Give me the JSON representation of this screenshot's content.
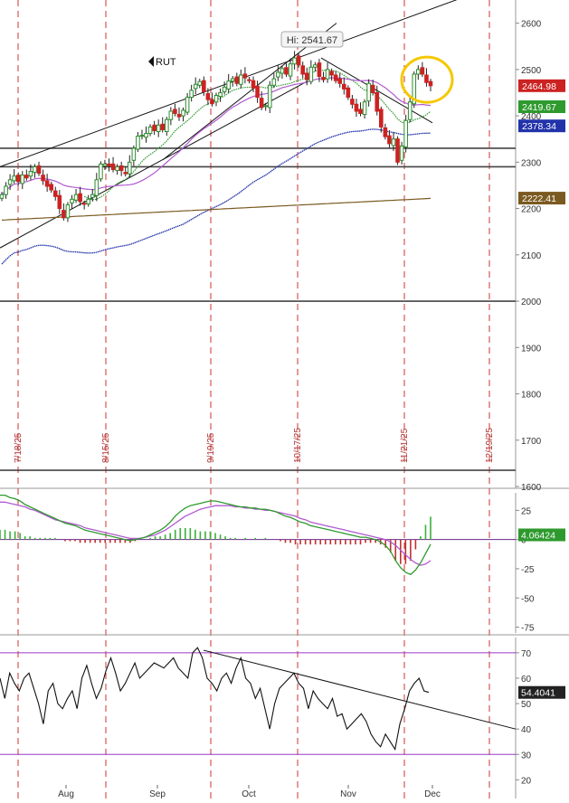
{
  "symbol": "RUT",
  "high_label": "Hi: 2541.67",
  "colors": {
    "up": "#2e8b2e",
    "down": "#cc2222",
    "ma_short": "#2e9a2e",
    "ma_mid": "#b05ad0",
    "ma_long": "#2233aa",
    "ma_200": "#7a5a20",
    "event_line": "#cc3333",
    "trend_line": "#111111",
    "highlight": "#f5c800",
    "macd_line": "#2e9a2e",
    "signal_line": "#b05ad0",
    "rsi_line": "#111111",
    "rsi_band": "#9a38c8"
  },
  "x_axis": {
    "labels": [
      "Aug",
      "Sep",
      "Oct",
      "Nov",
      "Dec"
    ]
  },
  "event_dates": [
    "7/18/25",
    "8/15/25",
    "9/19/25",
    "10/17/25",
    "11/21/25",
    "12/19/25"
  ],
  "chart_data": [
    {
      "type": "candlestick",
      "series_name": "RUT",
      "ylim": [
        1600,
        2650
      ],
      "y_ticks": [
        1600,
        1700,
        1800,
        1900,
        2000,
        2100,
        2200,
        2300,
        2400,
        2500,
        2600
      ],
      "horizontal_levels": [
        2330,
        2290,
        2000,
        1635
      ],
      "price_tags": [
        {
          "value": "2464.98",
          "level": 2464.98,
          "kind": "last"
        },
        {
          "value": "2419.67",
          "level": 2419.67,
          "kind": "ma_short"
        },
        {
          "value": "2378.34",
          "level": 2378.34,
          "kind": "ma_long"
        },
        {
          "value": "2222.41",
          "level": 2222.41,
          "kind": "ma_200"
        }
      ],
      "closes": [
        2230,
        2248,
        2262,
        2270,
        2258,
        2272,
        2266,
        2280,
        2290,
        2276,
        2260,
        2248,
        2240,
        2226,
        2200,
        2180,
        2208,
        2220,
        2230,
        2215,
        2210,
        2220,
        2230,
        2262,
        2296,
        2296,
        2292,
        2284,
        2290,
        2282,
        2275,
        2300,
        2330,
        2356,
        2358,
        2362,
        2376,
        2368,
        2380,
        2370,
        2392,
        2410,
        2405,
        2398,
        2412,
        2440,
        2455,
        2468,
        2474,
        2452,
        2435,
        2426,
        2444,
        2450,
        2462,
        2475,
        2480,
        2470,
        2488,
        2482,
        2476,
        2460,
        2440,
        2418,
        2422,
        2466,
        2480,
        2494,
        2502,
        2490,
        2512,
        2525,
        2510,
        2490,
        2478,
        2505,
        2510,
        2485,
        2478,
        2500,
        2488,
        2476,
        2470,
        2458,
        2440,
        2425,
        2410,
        2405,
        2430,
        2470,
        2450,
        2410,
        2376,
        2355,
        2340,
        2350,
        2300,
        2335,
        2390,
        2430,
        2490,
        2500,
        2490,
        2472,
        2465
      ]
    },
    {
      "type": "line",
      "indicator": "MACD",
      "ylim": [
        -80,
        40
      ],
      "y_ticks": [
        -75,
        -50,
        -25,
        0,
        25
      ],
      "last_value": "4.06424",
      "macd": [
        38,
        38,
        36,
        35,
        33,
        30,
        28,
        26,
        24,
        22,
        20,
        18,
        16,
        14,
        13,
        12,
        10,
        8,
        7,
        6,
        5,
        4,
        3,
        2,
        1,
        0,
        -1,
        0,
        1,
        2,
        4,
        6,
        8,
        11,
        15,
        20,
        24,
        27,
        29,
        30,
        31,
        32,
        33,
        33,
        32,
        31,
        30,
        29,
        28,
        28,
        27,
        27,
        26,
        26,
        25,
        24,
        22,
        20,
        19,
        17,
        15,
        14,
        12,
        11,
        10,
        9,
        8,
        7,
        6,
        5,
        4,
        3,
        2,
        2,
        1,
        0,
        -2,
        -5,
        -10,
        -18,
        -24,
        -28,
        -30,
        -26,
        -20,
        -12,
        -4
      ],
      "signal": [
        32,
        32,
        31,
        30,
        29,
        28,
        26,
        25,
        23,
        21,
        19,
        17,
        16,
        15,
        14,
        13,
        12,
        10,
        9,
        8,
        7,
        6,
        5,
        4,
        3,
        2,
        1,
        1,
        1,
        2,
        3,
        4,
        6,
        8,
        11,
        14,
        17,
        20,
        22,
        24,
        26,
        27,
        28,
        29,
        29,
        29,
        29,
        28,
        28,
        27,
        27,
        26,
        26,
        25,
        25,
        24,
        23,
        22,
        21,
        20,
        18,
        17,
        15,
        14,
        13,
        12,
        11,
        10,
        9,
        8,
        7,
        6,
        5,
        4,
        3,
        2,
        1,
        0,
        -2,
        -5,
        -9,
        -13,
        -17,
        -20,
        -22,
        -21,
        -18
      ]
    },
    {
      "type": "line",
      "indicator": "RSI",
      "ylim": [
        18,
        76
      ],
      "y_ticks": [
        20,
        30,
        40,
        50,
        60,
        70
      ],
      "bands": [
        70,
        30
      ],
      "last_value": "54.4041",
      "values": [
        60,
        52,
        62,
        58,
        55,
        60,
        62,
        56,
        50,
        42,
        55,
        58,
        50,
        48,
        52,
        55,
        48,
        60,
        65,
        58,
        52,
        56,
        63,
        68,
        62,
        55,
        58,
        62,
        66,
        60,
        62,
        64,
        66,
        65,
        64,
        66,
        68,
        64,
        62,
        60,
        70,
        72,
        68,
        60,
        58,
        55,
        60,
        62,
        58,
        64,
        68,
        60,
        58,
        52,
        56,
        48,
        40,
        50,
        56,
        58,
        60,
        62,
        58,
        56,
        48,
        55,
        52,
        50,
        48,
        52,
        45,
        46,
        40,
        42,
        44,
        46,
        43,
        38,
        35,
        33,
        38,
        35,
        32,
        42,
        48,
        55,
        58,
        60,
        55,
        54.4
      ]
    }
  ]
}
